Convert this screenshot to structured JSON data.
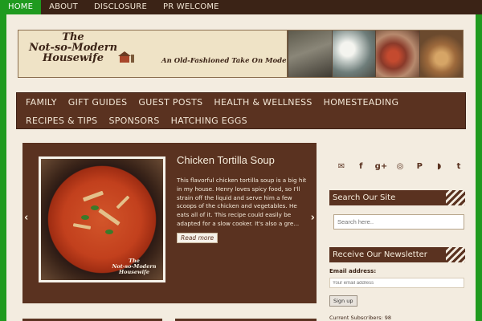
{
  "top_nav": {
    "items": [
      "HOME",
      "ABOUT",
      "DISCLOSURE",
      "PR WELCOME"
    ],
    "active": "HOME"
  },
  "banner": {
    "title": "The Not-so-Modern Housewife",
    "title_lines": [
      "The",
      "Not-so-Modern",
      "Housewife"
    ],
    "tagline": "An Old-Fashioned Take On Modern Living"
  },
  "category_menu": {
    "items": [
      "FAMILY",
      "GIFT GUIDES",
      "GUEST POSTS",
      "HEALTH & WELLNESS",
      "HOMESTEADING",
      "RECIPES & TIPS",
      "SPONSORS",
      "HATCHING EGGS"
    ]
  },
  "slider": {
    "title": "Chicken Tortilla Soup",
    "excerpt": "This flavorful chicken tortilla soup is a big hit in my house.  Henry loves spicy food, so I'll strain off the liquid and serve him a few scoops of the chicken and vegetables.  He eats all of it.  This recipe could easily be adapted for a slow cooker.  It's also a gre...",
    "read_more": "Read more",
    "image_watermark": [
      "The",
      "Not-so-Modern",
      "Housewife"
    ],
    "prev_arrow": "‹",
    "next_arrow": "›"
  },
  "sidebar": {
    "social_icons": [
      "mail-icon",
      "facebook-icon",
      "google-plus-icon",
      "instagram-icon",
      "pinterest-icon",
      "rss-icon",
      "twitter-icon"
    ],
    "social_glyphs": [
      "✉",
      "f",
      "g+",
      "◎",
      "P",
      "◗",
      "t"
    ],
    "search": {
      "heading": "Search Our Site",
      "placeholder": "Search here.."
    },
    "newsletter": {
      "heading": "Receive Our Newsletter",
      "email_label": "Email address:",
      "email_placeholder": "Your email address",
      "signup_label": "Sign up",
      "subscribers": "Current Subscribers: 98"
    }
  },
  "colors": {
    "accent_green": "#1f9a1f",
    "dark_brown": "#3b2316",
    "menu_brown": "#5a3220",
    "background": "#f3ece0"
  }
}
